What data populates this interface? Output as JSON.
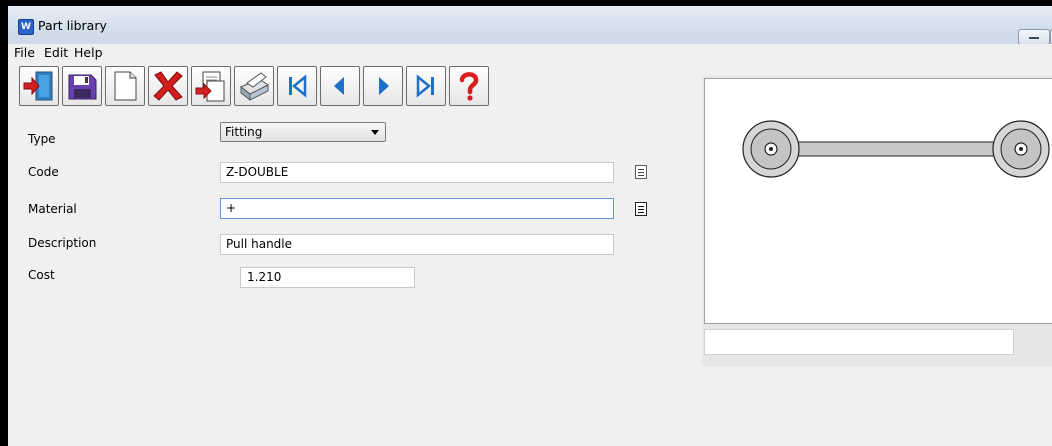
{
  "window": {
    "title": "Part library",
    "app_icon": "W"
  },
  "menu": [
    "File",
    "Edit",
    "Help"
  ],
  "toolbar": {
    "buttons": [
      {
        "name": "exit-button",
        "icon": "exit-door-icon"
      },
      {
        "name": "save-button",
        "icon": "floppy-disk-icon"
      },
      {
        "name": "new-button",
        "icon": "blank-page-icon"
      },
      {
        "name": "delete-button",
        "icon": "red-x-icon"
      },
      {
        "name": "copy-button",
        "icon": "copy-document-icon"
      },
      {
        "name": "print-button",
        "icon": "printer-icon"
      },
      {
        "name": "first-record-button",
        "icon": "first-icon"
      },
      {
        "name": "previous-record-button",
        "icon": "previous-icon"
      },
      {
        "name": "next-record-button",
        "icon": "next-icon"
      },
      {
        "name": "last-record-button",
        "icon": "last-icon"
      },
      {
        "name": "help-button",
        "icon": "question-mark-icon"
      }
    ]
  },
  "form": {
    "type_label": "Type",
    "type_value": "Fitting",
    "code_label": "Code",
    "code_value": "Z-DOUBLE",
    "material_label": "Material",
    "material_value": "+",
    "description_label": "Description",
    "description_value": "Pull handle",
    "cost_label": "Cost",
    "cost_value": "1.210"
  },
  "preview": {
    "status_value": ""
  },
  "colors": {
    "titlebar": "#d3deec",
    "client": "#f0f0f0",
    "focus_border": "#5f9ad6",
    "handle_fill": "#c8c8c8"
  }
}
